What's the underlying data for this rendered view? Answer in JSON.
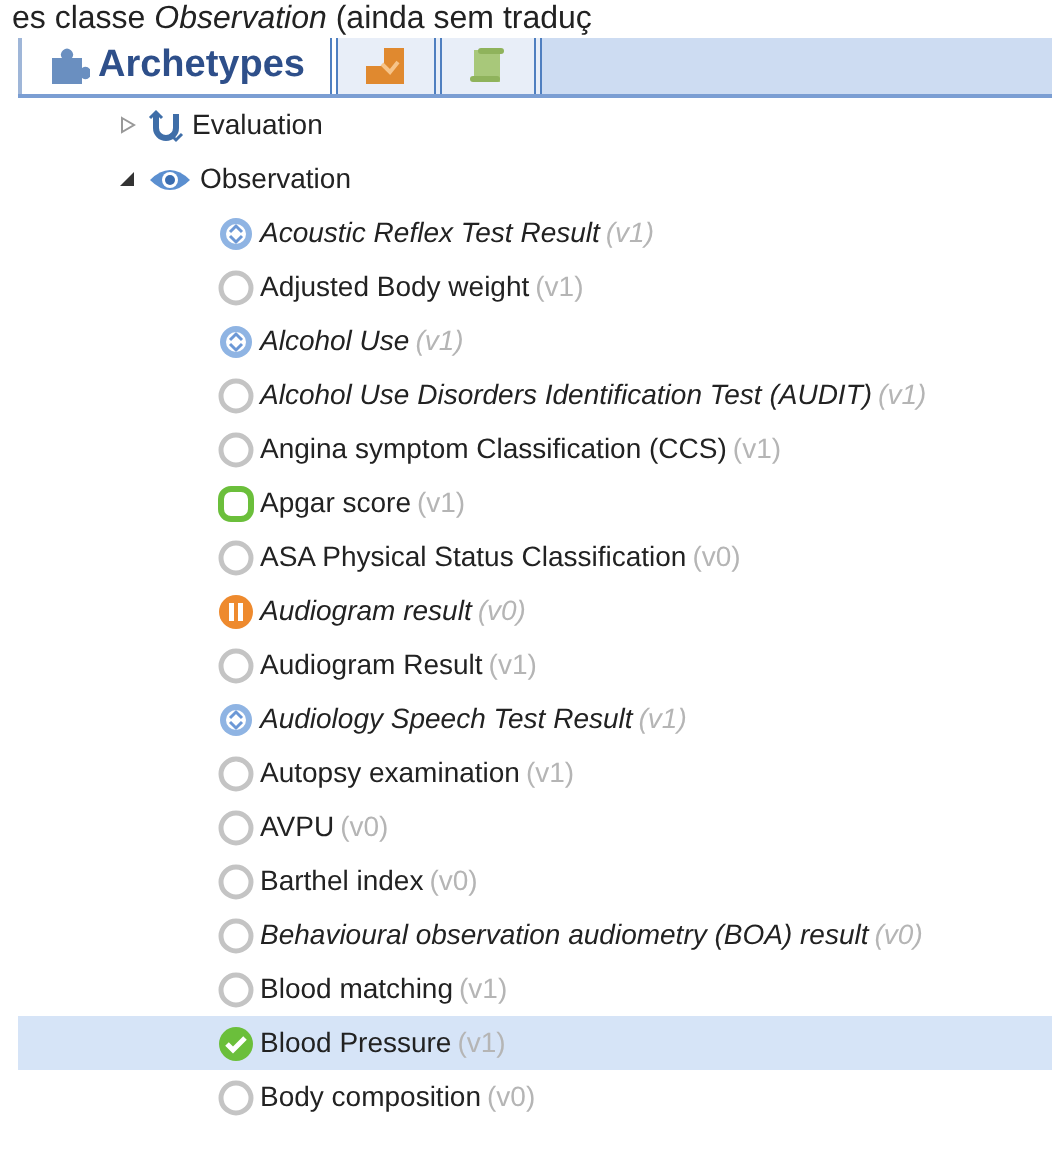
{
  "caption": "es classe *Observation* (ainda sem traduç",
  "tabs": [
    {
      "kind": "archetypes",
      "label": "Archetypes",
      "selected": true
    },
    {
      "kind": "templates",
      "selected": false
    },
    {
      "kind": "documents",
      "selected": false
    }
  ],
  "tree": [
    {
      "label": "Evaluation",
      "kind": "evaluation",
      "expanded": false
    },
    {
      "label": "Observation",
      "kind": "observation",
      "expanded": true,
      "children": [
        {
          "name": "Acoustic Reflex Test Result",
          "version": "(v1)",
          "kind": "draft",
          "italic": true,
          "selected": false
        },
        {
          "name": "Adjusted Body weight",
          "version": "(v1)",
          "kind": "none",
          "italic": false,
          "selected": false
        },
        {
          "name": "Alcohol Use",
          "version": "(v1)",
          "kind": "draft",
          "italic": true,
          "selected": false
        },
        {
          "name": "Alcohol Use Disorders Identification Test (AUDIT)",
          "version": "(v1)",
          "kind": "none",
          "italic": true,
          "selected": false
        },
        {
          "name": "Angina symptom Classification (CCS)",
          "version": "(v1)",
          "kind": "none",
          "italic": false,
          "selected": false
        },
        {
          "name": "Apgar score",
          "version": "(v1)",
          "kind": "published",
          "italic": false,
          "selected": false
        },
        {
          "name": "ASA Physical Status Classification",
          "version": "(v0)",
          "kind": "none",
          "italic": false,
          "selected": false
        },
        {
          "name": "Audiogram result",
          "version": "(v0)",
          "kind": "paused",
          "italic": true,
          "selected": false
        },
        {
          "name": "Audiogram Result",
          "version": "(v1)",
          "kind": "none",
          "italic": false,
          "selected": false
        },
        {
          "name": "Audiology Speech Test Result",
          "version": "(v1)",
          "kind": "draft",
          "italic": true,
          "selected": false
        },
        {
          "name": "Autopsy examination",
          "version": "(v1)",
          "kind": "none",
          "italic": false,
          "selected": false
        },
        {
          "name": "AVPU",
          "version": "(v0)",
          "kind": "none",
          "italic": false,
          "selected": false
        },
        {
          "name": "Barthel index",
          "version": "(v0)",
          "kind": "none",
          "italic": false,
          "selected": false
        },
        {
          "name": "Behavioural observation audiometry (BOA) result",
          "version": "(v0)",
          "kind": "none",
          "italic": true,
          "selected": false
        },
        {
          "name": "Blood matching",
          "version": "(v1)",
          "kind": "none",
          "italic": false,
          "selected": false
        },
        {
          "name": "Blood Pressure",
          "version": "(v1)",
          "kind": "approved",
          "italic": false,
          "selected": true
        },
        {
          "name": "Body composition",
          "version": "(v0)",
          "kind": "none",
          "italic": false,
          "selected": false
        }
      ]
    }
  ]
}
